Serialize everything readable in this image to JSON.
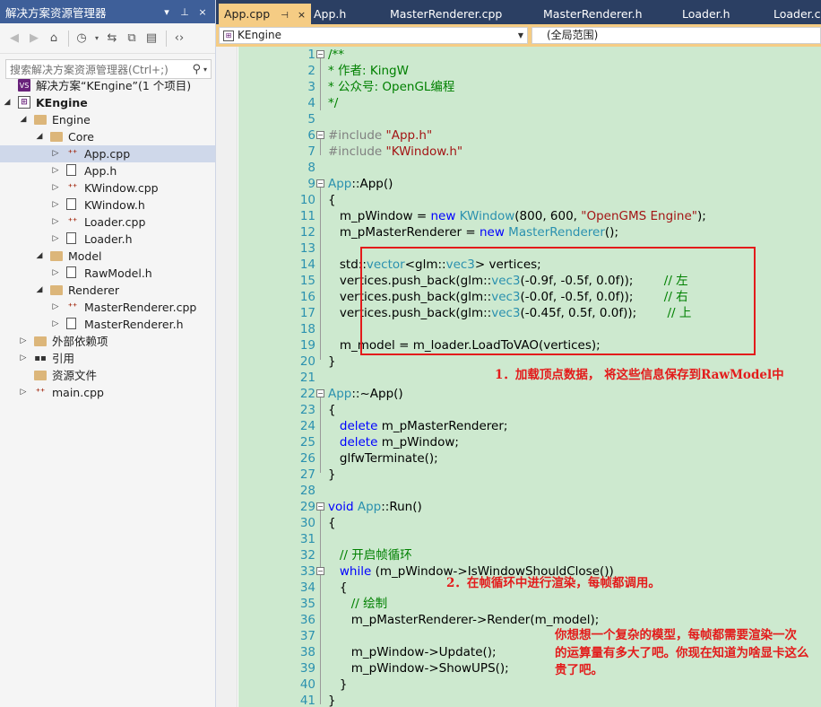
{
  "explorer": {
    "title": "解决方案资源管理器",
    "title_buttons": [
      "▾",
      "⊥",
      "×"
    ],
    "search_placeholder": "搜索解决方案资源管理器(Ctrl+;)",
    "tree": [
      {
        "label": "解决方案“KEngine”(1 个项目)",
        "icon": "solution-icon",
        "depth": 0,
        "expander": ""
      },
      {
        "label": "KEngine",
        "icon": "project-icon",
        "depth": 0,
        "expander": "◢",
        "bold": true
      },
      {
        "label": "Engine",
        "icon": "folder-icon",
        "depth": 1,
        "expander": "◢"
      },
      {
        "label": "Core",
        "icon": "folder-icon",
        "depth": 2,
        "expander": "◢"
      },
      {
        "label": "App.cpp",
        "icon": "cpp-file-icon",
        "depth": 3,
        "expander": "▷",
        "selected": true
      },
      {
        "label": "App.h",
        "icon": "header-file-icon",
        "depth": 3,
        "expander": "▷"
      },
      {
        "label": "KWindow.cpp",
        "icon": "cpp-file-icon",
        "depth": 3,
        "expander": "▷"
      },
      {
        "label": "KWindow.h",
        "icon": "header-file-icon",
        "depth": 3,
        "expander": "▷"
      },
      {
        "label": "Loader.cpp",
        "icon": "cpp-file-icon",
        "depth": 3,
        "expander": "▷"
      },
      {
        "label": "Loader.h",
        "icon": "header-file-icon",
        "depth": 3,
        "expander": "▷"
      },
      {
        "label": "Model",
        "icon": "folder-icon",
        "depth": 2,
        "expander": "◢"
      },
      {
        "label": "RawModel.h",
        "icon": "header-file-icon",
        "depth": 3,
        "expander": "▷"
      },
      {
        "label": "Renderer",
        "icon": "folder-icon",
        "depth": 2,
        "expander": "◢"
      },
      {
        "label": "MasterRenderer.cpp",
        "icon": "cpp-file-icon",
        "depth": 3,
        "expander": "▷"
      },
      {
        "label": "MasterRenderer.h",
        "icon": "header-file-icon",
        "depth": 3,
        "expander": "▷"
      },
      {
        "label": "外部依赖项",
        "icon": "external-deps-icon",
        "depth": 1,
        "expander": "▷"
      },
      {
        "label": "引用",
        "icon": "references-icon",
        "depth": 1,
        "expander": "▷"
      },
      {
        "label": "资源文件",
        "icon": "folder-icon",
        "depth": 1,
        "expander": ""
      },
      {
        "label": "main.cpp",
        "icon": "cpp-file-icon",
        "depth": 1,
        "expander": "▷"
      }
    ]
  },
  "tabs": [
    {
      "label": "App.cpp",
      "active": true,
      "pin": "⊣",
      "close": "×"
    },
    {
      "label": "App.h"
    },
    {
      "label": "MasterRenderer.cpp"
    },
    {
      "label": "MasterRenderer.h"
    },
    {
      "label": "Loader.h"
    },
    {
      "label": "Loader.cpp"
    }
  ],
  "navbar": {
    "project": "KEngine",
    "scope": "(全局范围)"
  },
  "code_lines": [
    {
      "n": "1",
      "tokens": [
        [
          "c-com",
          "/**"
        ]
      ]
    },
    {
      "n": "2",
      "tokens": [
        [
          "c-com",
          "* 作者: KingW"
        ]
      ]
    },
    {
      "n": "3",
      "tokens": [
        [
          "c-com",
          "* 公众号: OpenGL编程"
        ]
      ]
    },
    {
      "n": "4",
      "tokens": [
        [
          "c-com",
          "*/"
        ]
      ]
    },
    {
      "n": "5",
      "tokens": []
    },
    {
      "n": "6",
      "tokens": [
        [
          "c-pp",
          "#include "
        ],
        [
          "c-str",
          "\"App.h\""
        ]
      ]
    },
    {
      "n": "7",
      "tokens": [
        [
          "c-pp",
          "#include "
        ],
        [
          "c-str",
          "\"KWindow.h\""
        ]
      ]
    },
    {
      "n": "8",
      "tokens": []
    },
    {
      "n": "9",
      "tokens": [
        [
          "c-type",
          "App"
        ],
        [
          "",
          "::App()"
        ]
      ]
    },
    {
      "n": "10",
      "tokens": [
        [
          "",
          "{"
        ]
      ]
    },
    {
      "n": "11",
      "tokens": [
        [
          "",
          "   m_pWindow = "
        ],
        [
          "c-kw",
          "new "
        ],
        [
          "c-type",
          "KWindow"
        ],
        [
          "",
          "(800, 600, "
        ],
        [
          "c-str",
          "\"OpenGMS Engine\""
        ],
        [
          "",
          ");"
        ]
      ]
    },
    {
      "n": "12",
      "tokens": [
        [
          "",
          "   m_pMasterRenderer = "
        ],
        [
          "c-kw",
          "new "
        ],
        [
          "c-type",
          "MasterRenderer"
        ],
        [
          "",
          "();"
        ]
      ]
    },
    {
      "n": "13",
      "tokens": []
    },
    {
      "n": "14",
      "tokens": [
        [
          "",
          "   std::"
        ],
        [
          "c-type",
          "vector"
        ],
        [
          "",
          "<glm::"
        ],
        [
          "c-type",
          "vec3"
        ],
        [
          "",
          "> vertices;"
        ]
      ]
    },
    {
      "n": "15",
      "tokens": [
        [
          "",
          "   vertices.push_back(glm::"
        ],
        [
          "c-type",
          "vec3"
        ],
        [
          "",
          "(-0.9f, -0.5f, 0.0f));        "
        ],
        [
          "c-com",
          "// 左"
        ]
      ]
    },
    {
      "n": "16",
      "tokens": [
        [
          "",
          "   vertices.push_back(glm::"
        ],
        [
          "c-type",
          "vec3"
        ],
        [
          "",
          "(-0.0f, -0.5f, 0.0f));        "
        ],
        [
          "c-com",
          "// 右"
        ]
      ]
    },
    {
      "n": "17",
      "tokens": [
        [
          "",
          "   vertices.push_back(glm::"
        ],
        [
          "c-type",
          "vec3"
        ],
        [
          "",
          "(-0.45f, 0.5f, 0.0f));        "
        ],
        [
          "c-com",
          "// 上"
        ]
      ]
    },
    {
      "n": "18",
      "tokens": []
    },
    {
      "n": "19",
      "tokens": [
        [
          "",
          "   m_model = m_loader.LoadToVAO(vertices);"
        ]
      ]
    },
    {
      "n": "20",
      "tokens": [
        [
          "",
          "}"
        ]
      ]
    },
    {
      "n": "21",
      "tokens": []
    },
    {
      "n": "22",
      "tokens": [
        [
          "c-type",
          "App"
        ],
        [
          "",
          "::~App()"
        ]
      ]
    },
    {
      "n": "23",
      "tokens": [
        [
          "",
          "{"
        ]
      ]
    },
    {
      "n": "24",
      "tokens": [
        [
          "",
          "   "
        ],
        [
          "c-kw",
          "delete "
        ],
        [
          "",
          "m_pMasterRenderer;"
        ]
      ]
    },
    {
      "n": "25",
      "tokens": [
        [
          "",
          "   "
        ],
        [
          "c-kw",
          "delete "
        ],
        [
          "",
          "m_pWindow;"
        ]
      ]
    },
    {
      "n": "26",
      "tokens": [
        [
          "",
          "   glfwTerminate();"
        ]
      ]
    },
    {
      "n": "27",
      "tokens": [
        [
          "",
          "}"
        ]
      ]
    },
    {
      "n": "28",
      "tokens": []
    },
    {
      "n": "29",
      "tokens": [
        [
          "c-kw",
          "void "
        ],
        [
          "c-type",
          "App"
        ],
        [
          "",
          "::Run()"
        ]
      ]
    },
    {
      "n": "30",
      "tokens": [
        [
          "",
          "{"
        ]
      ]
    },
    {
      "n": "31",
      "tokens": []
    },
    {
      "n": "32",
      "tokens": [
        [
          "",
          "   "
        ],
        [
          "c-com",
          "// 开启帧循环"
        ]
      ]
    },
    {
      "n": "33",
      "tokens": [
        [
          "",
          "   "
        ],
        [
          "c-kw",
          "while "
        ],
        [
          "",
          "(m_pWindow->IsWindowShouldClose())"
        ]
      ]
    },
    {
      "n": "34",
      "tokens": [
        [
          "",
          "   {"
        ]
      ]
    },
    {
      "n": "35",
      "tokens": [
        [
          "",
          "      "
        ],
        [
          "c-com",
          "// 绘制"
        ]
      ]
    },
    {
      "n": "36",
      "tokens": [
        [
          "",
          "      m_pMasterRenderer->Render(m_model);"
        ]
      ]
    },
    {
      "n": "37",
      "tokens": []
    },
    {
      "n": "38",
      "tokens": [
        [
          "",
          "      m_pWindow->Update();"
        ]
      ]
    },
    {
      "n": "39",
      "tokens": [
        [
          "",
          "      m_pWindow->ShowUPS();"
        ]
      ]
    },
    {
      "n": "40",
      "tokens": [
        [
          "",
          "   }"
        ]
      ]
    },
    {
      "n": "41",
      "tokens": [
        [
          "",
          "}"
        ]
      ]
    }
  ],
  "annotations": {
    "note1": "1．加载顶点数据， 将这些信息保存到RawModel中",
    "note2": "2．在帧循环中进行渲染，每帧都调用。",
    "note3_line1": "你想想一个复杂的模型，每帧都需要渲染一次",
    "note3_line2": "的运算量有多大了吧。你现在知道为啥显卡这么",
    "note3_line3": "贵了吧。"
  },
  "colors": {
    "accent_tab": "#f5cc84",
    "code_bg": "#cde9cf",
    "annotation_red": "#e31b1b"
  }
}
